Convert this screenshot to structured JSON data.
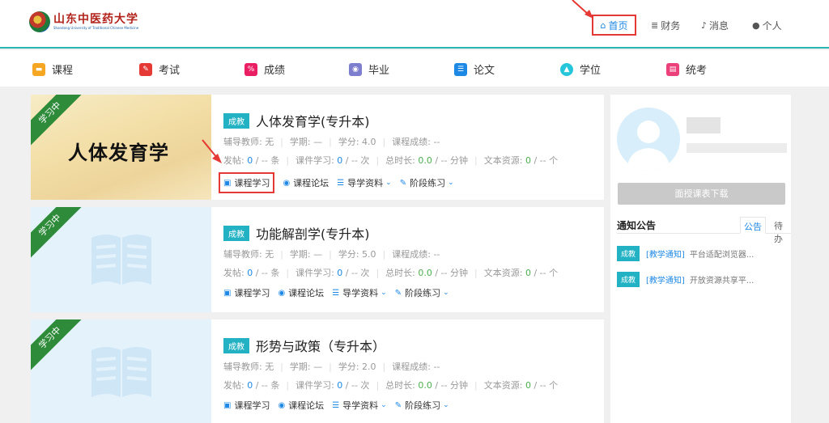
{
  "header": {
    "logo_cn": "山东中医药大学",
    "logo_en": "Shandong University of Traditional Chinese Medicine",
    "nav": [
      {
        "label": "首页",
        "icon": "home-icon"
      },
      {
        "label": "财务",
        "icon": "database-icon"
      },
      {
        "label": "消息",
        "icon": "bell-icon"
      },
      {
        "label": "个人",
        "icon": "user-icon"
      }
    ]
  },
  "modules": [
    {
      "label": "课程",
      "icon": "course-icon",
      "color": "#f5a623"
    },
    {
      "label": "考试",
      "icon": "exam-icon",
      "color": "#e53935"
    },
    {
      "label": "成绩",
      "icon": "score-icon",
      "color": "#e91e63"
    },
    {
      "label": "毕业",
      "icon": "graduation-icon",
      "color": "#7e7ecf"
    },
    {
      "label": "论文",
      "icon": "paper-icon",
      "color": "#1e88e5"
    },
    {
      "label": "学位",
      "icon": "degree-cap-icon",
      "color": "#26c6da"
    },
    {
      "label": "统考",
      "icon": "unified-exam-icon",
      "color": "#ec407a"
    }
  ],
  "courses": [
    {
      "ribbon": "学习中",
      "thumb_title": "人体发育学",
      "tag": "成教",
      "title": "人体发育学(专升本)",
      "tutor": "辅导教师: 无",
      "term": "学期: —",
      "credit": "学分: 4.0",
      "grade": "课程成绩: --",
      "posts_label": "发帖:",
      "posts_done": "0",
      "posts_total": "/ -- 条",
      "study_label": "课件学习:",
      "study_done": "0",
      "study_total": "/ -- 次",
      "duration_label": "总时长:",
      "duration_done": "0.0",
      "duration_total": "/ -- 分钟",
      "resource_label": "文本资源:",
      "resource_done": "0",
      "resource_total": "/ -- 个"
    },
    {
      "ribbon": "学习中",
      "tag": "成教",
      "title": "功能解剖学(专升本)",
      "tutor": "辅导教师: 无",
      "term": "学期: —",
      "credit": "学分: 5.0",
      "grade": "课程成绩: --",
      "posts_label": "发帖:",
      "posts_done": "0",
      "posts_total": "/ -- 条",
      "study_label": "课件学习:",
      "study_done": "0",
      "study_total": "/ -- 次",
      "duration_label": "总时长:",
      "duration_done": "0.0",
      "duration_total": "/ -- 分钟",
      "resource_label": "文本资源:",
      "resource_done": "0",
      "resource_total": "/ -- 个"
    },
    {
      "ribbon": "学习中",
      "tag": "成教",
      "title": "形势与政策（专升本）",
      "tutor": "辅导教师: 无",
      "term": "学期: —",
      "credit": "学分: 2.0",
      "grade": "课程成绩: --",
      "posts_label": "发帖:",
      "posts_done": "0",
      "posts_total": "/ -- 条",
      "study_label": "课件学习:",
      "study_done": "0",
      "study_total": "/ -- 次",
      "duration_label": "总时长:",
      "duration_done": "0.0",
      "duration_total": "/ -- 分钟",
      "resource_label": "文本资源:",
      "resource_done": "0",
      "resource_total": "/ -- 个"
    }
  ],
  "actions": {
    "study": "课程学习",
    "forum": "课程论坛",
    "guide": "导学资料",
    "practice": "阶段练习"
  },
  "sidebar": {
    "download_button": "面授课表下载",
    "notice_title": "通知公告",
    "tabs": [
      "公告",
      "待办"
    ],
    "notices": [
      {
        "tag": "成教",
        "category": "[教学通知]",
        "text": "平台适配浏览器..."
      },
      {
        "tag": "成教",
        "category": "[教学通知]",
        "text": "开放资源共享平..."
      }
    ]
  },
  "colors": {
    "accent": "#29b6b0",
    "link": "#1e88e5",
    "tag": "#23b2c4",
    "ribbon": "#2e8b3a",
    "highlight": "#e53935"
  }
}
